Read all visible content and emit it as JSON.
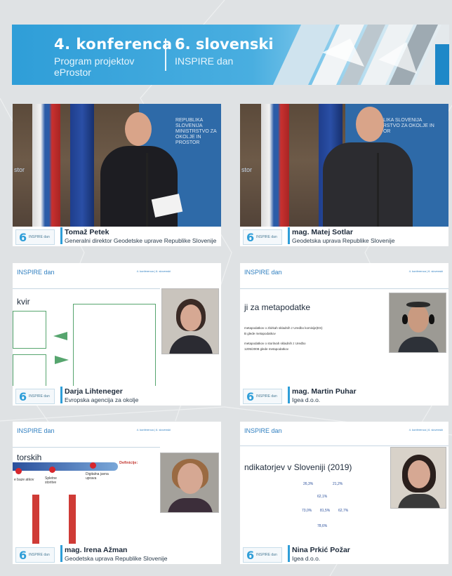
{
  "banner": {
    "conference_title": "4. konferenca",
    "conference_sub": "Program projektov eProstor",
    "day_title": "6. slovenski",
    "day_sub": "INSPIRE dan"
  },
  "logo": {
    "six": "6",
    "text": "INSPIRE dan"
  },
  "tiles": [
    {
      "name": "Tomaž Petek",
      "role": "Generalni direktor Geodetske uprave Republike Slovenije"
    },
    {
      "name": "mag. Matej Sotlar",
      "role": "Geodetska uprava Republike Slovenije"
    },
    {
      "name": "Darja Lihteneger",
      "role": "Evropska agencija za okolje"
    },
    {
      "name": "mag. Martin Puhar",
      "role": "Igea d.o.o."
    },
    {
      "name": "mag. Irena Ažman",
      "role": "Geodetska uprava Republike Slovenije"
    },
    {
      "name": "Nina Prkić Požar",
      "role": "Igea d.o.o."
    }
  ],
  "wall": {
    "ministry": "REPUBLIKA SLOVENIJA MINISTRSTVO ZA OKOLJE IN PROSTOR",
    "storeLeft": "stor"
  },
  "slides": {
    "header_left": "INSPIRE dan",
    "header_right": "4. konferenca | 6. slovenski",
    "s3_title": "kvir",
    "s4_title": "ji za metapodatke",
    "s4_lines": [
      "metapodatkov o zbirkah skladnih z Uredbo komisije(ES)",
      "B glede metapodatkov",
      "metapodatkov o storitvah skladnih z Uredbo",
      "1205/2008 glede metapodatkov"
    ],
    "s5_title": "torskih",
    "s5_nodes": [
      "Spletne storitve",
      "Digitalna javna uprava"
    ],
    "s5_left": "e baze atkov",
    "s5_def": "Definicije:",
    "s6_title": "ndikatorjev v Sloveniji (2019)",
    "s6_kpis": [
      "26,3%",
      "21,2%",
      "62,1%",
      "73,0%",
      "81,5%",
      "62,7%",
      "78,6%"
    ]
  },
  "colors": {
    "accent": "#2f9ed8",
    "caption_bg": "#ffffff",
    "background": "#dfe2e4"
  }
}
